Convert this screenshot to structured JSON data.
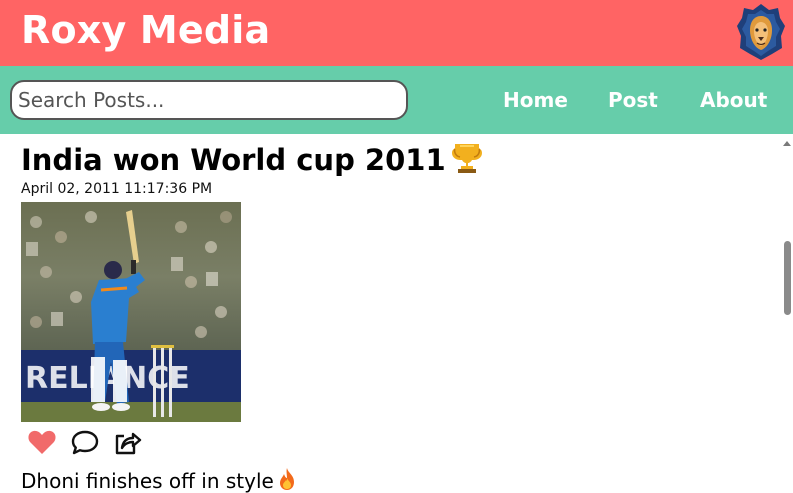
{
  "header": {
    "brand": "Roxy Media",
    "logo_icon": "lion-logo-icon"
  },
  "nav": {
    "search_placeholder": "Search Posts...",
    "links": [
      "Home",
      "Post",
      "About"
    ]
  },
  "post": {
    "title": "India won World cup 2011",
    "title_emoji_icon": "trophy-icon",
    "date": "April 02, 2011 11:17:36 PM",
    "image_icon": "cricket-batsman-photo",
    "actions": [
      "heart-icon",
      "comment-icon",
      "share-icon"
    ],
    "liked": true,
    "caption": "Dhoni finishes off in style",
    "caption_emoji_icon": "fire-icon"
  },
  "colors": {
    "header_bg": "#ff6464",
    "nav_bg": "#66cdaa",
    "like": "#f16a6a"
  }
}
